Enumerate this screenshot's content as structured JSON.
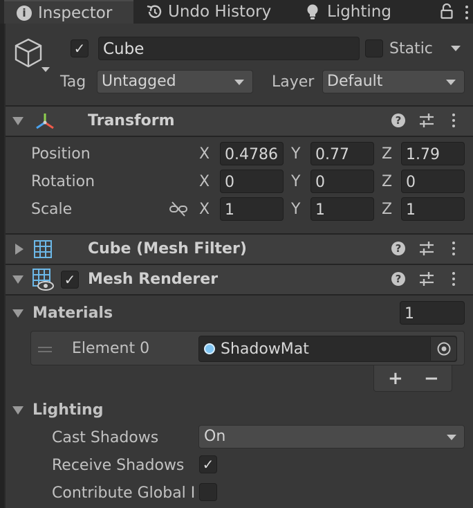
{
  "tabs": [
    {
      "label": "Inspector",
      "icon": "info-icon",
      "active": true
    },
    {
      "label": "Undo History",
      "icon": "history-icon",
      "active": false
    },
    {
      "label": "Lighting",
      "icon": "lightbulb-icon",
      "active": false
    }
  ],
  "header": {
    "object_name": "Cube",
    "active": true,
    "static_label": "Static",
    "static_checked": false,
    "tag_label": "Tag",
    "tag_value": "Untagged",
    "layer_label": "Layer",
    "layer_value": "Default"
  },
  "transform": {
    "title": "Transform",
    "rows": [
      {
        "label": "Position",
        "x": "0.4786",
        "y": "0.77",
        "z": "1.79"
      },
      {
        "label": "Rotation",
        "x": "0",
        "y": "0",
        "z": "0"
      },
      {
        "label": "Scale",
        "x": "1",
        "y": "1",
        "z": "1"
      }
    ],
    "axis_x": "X",
    "axis_y": "Y",
    "axis_z": "Z"
  },
  "mesh_filter": {
    "title": "Cube (Mesh Filter)"
  },
  "mesh_renderer": {
    "title": "Mesh Renderer",
    "enabled": true,
    "materials_label": "Materials",
    "materials_count": "1",
    "element_label": "Element 0",
    "element_value": "ShadowMat",
    "add_label": "+",
    "remove_label": "−",
    "lighting_label": "Lighting",
    "cast_shadows_label": "Cast Shadows",
    "cast_shadows_value": "On",
    "receive_shadows_label": "Receive Shadows",
    "receive_shadows_checked": true,
    "contribute_gi_label": "Contribute Global I",
    "contribute_gi_checked": false
  },
  "colors": {
    "panel": "#383838",
    "tabbar": "#282828",
    "field": "#2a2a2a",
    "material_dot": "#7fc4f2"
  }
}
